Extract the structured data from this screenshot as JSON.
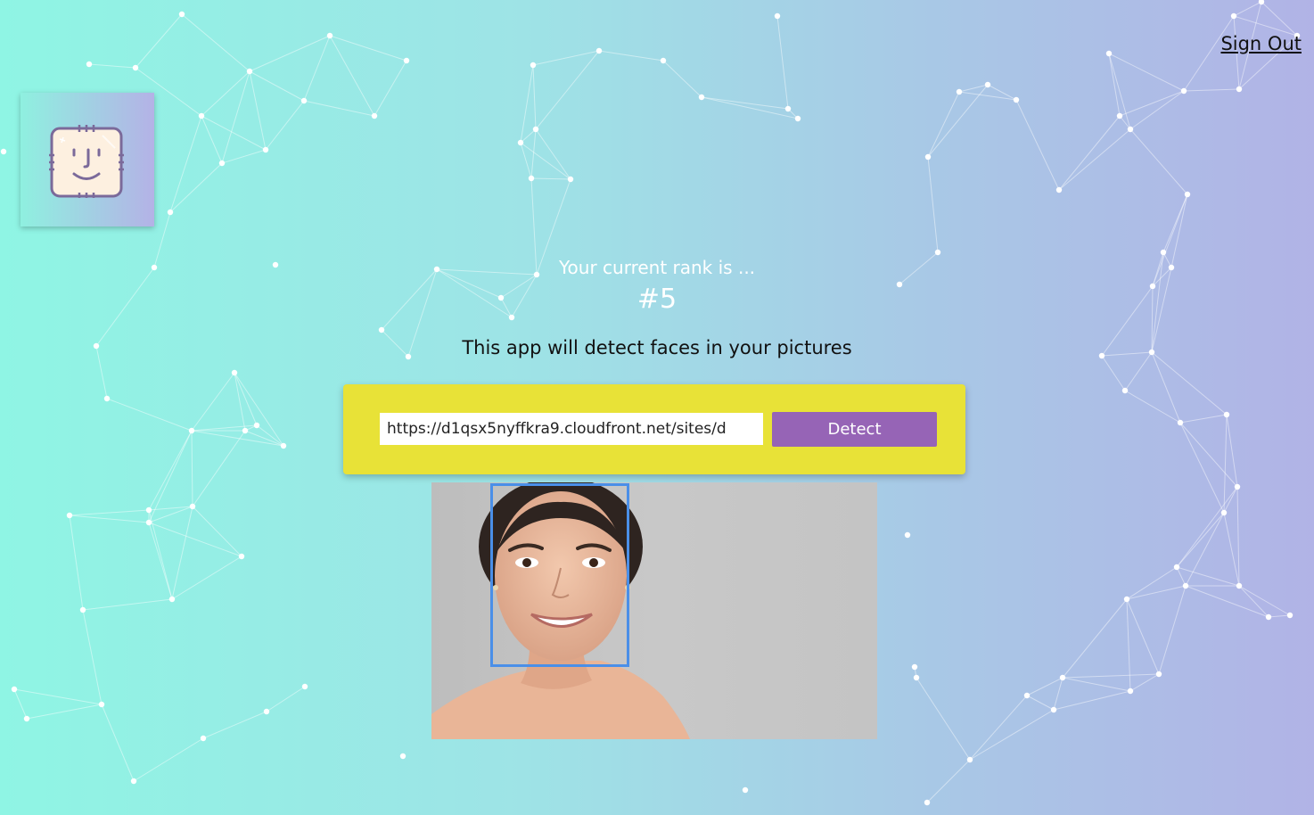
{
  "header": {
    "sign_out_label": "Sign Out"
  },
  "logo": {
    "icon": "face-id-icon"
  },
  "rank": {
    "label": "Your current rank is ...",
    "value": "#5"
  },
  "description": "This app will detect faces in your pictures",
  "form": {
    "url_value": "https://d1qsx5nyffkra9.cloudfront.net/sites/d",
    "detect_label": "Detect"
  },
  "colors": {
    "accent_yellow": "#e8e237",
    "button_purple": "#9664b6",
    "face_box_blue": "#4a8fe8",
    "gradient_start": "#8ff5e4",
    "gradient_end": "#b1b3e6"
  }
}
